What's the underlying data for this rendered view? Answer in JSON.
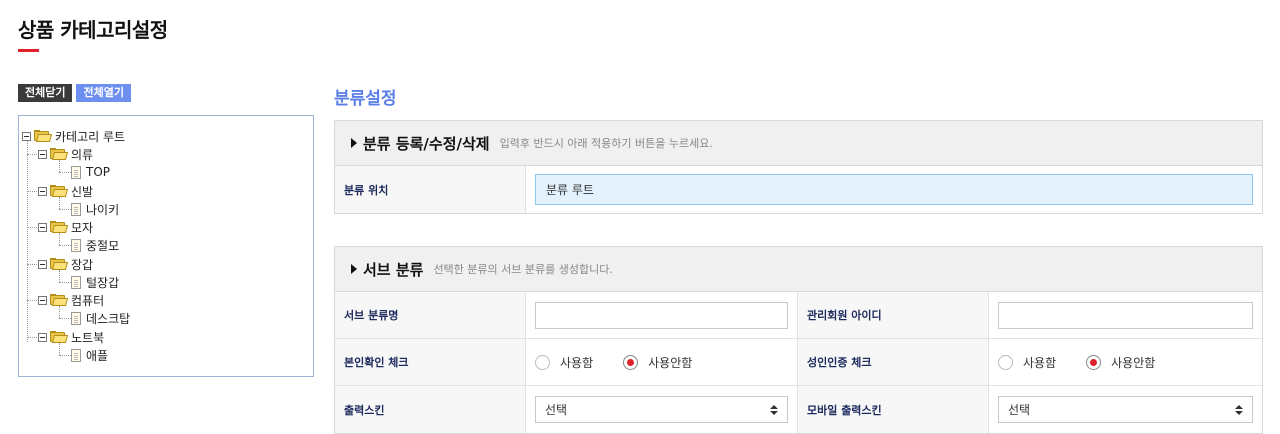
{
  "page": {
    "title": "상품 카테고리설정",
    "accent": "#e0202a"
  },
  "tree_controls": {
    "collapse_all": "전체닫기",
    "expand_all": "전체열기"
  },
  "tree": {
    "root": "카테고리 루트",
    "groups": [
      {
        "label": "의류",
        "child": "TOP"
      },
      {
        "label": "신발",
        "child": "나이키"
      },
      {
        "label": "모자",
        "child": "중절모"
      },
      {
        "label": "장갑",
        "child": "털장갑"
      },
      {
        "label": "컴퓨터",
        "child": "데스크탑"
      },
      {
        "label": "노트북",
        "child": "애플"
      }
    ]
  },
  "settings": {
    "title": "분류설정",
    "edit_panel": {
      "heading": "분류 등록/수정/삭제",
      "hint": "입력후 반드시 아래 적용하기 버튼을 누르세요.",
      "location_label": "분류 위치",
      "location_value": "분류 루트"
    },
    "sub_panel": {
      "heading": "서브 분류",
      "hint": "선택한 분류의 서브 분류를 생성합니다.",
      "name_label": "서브 분류명",
      "admin_label": "관리회원 아이디",
      "identity_label": "본인확인 체크",
      "adult_label": "성인인증 체크",
      "use_label": "사용함",
      "not_use_label": "사용안함",
      "identity_selected": "사용안함",
      "adult_selected": "사용안함",
      "skin_label": "출력스킨",
      "mobile_skin_label": "모바일 출력스킨",
      "skin_value": "선택",
      "mobile_skin_value": "선택"
    }
  }
}
